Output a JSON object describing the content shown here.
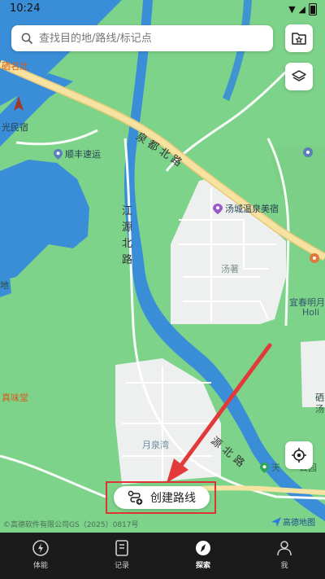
{
  "status_bar": {
    "time": "10:24"
  },
  "search": {
    "placeholder": "查找目的地/路线/标记点"
  },
  "map": {
    "poi": {
      "shunfeng": "顺丰速运",
      "tangcheng_hotel": "汤城温泉美宿",
      "yichun_holi": "宜春明月",
      "holi": "Holi",
      "zhenweitang": "真味堂",
      "tianshan": "天",
      "gongyuan": "公园",
      "guangminsu": "光民宿",
      "mingchaimingzao": "硒名灶",
      "xi_tang": "硒",
      "tang": "汤"
    },
    "roads": {
      "quandu_north": "泉都北路",
      "jiangyuan_north": "江源北路",
      "yuan_north": "源北路"
    },
    "areas": {
      "tangzhu": "汤著",
      "yuequanwan": "月泉湾",
      "di": "地"
    }
  },
  "actions": {
    "create_route": "创建路线"
  },
  "copyright": "©高德软件有限公司GS（2025）0817号",
  "map_provider": "高德地图",
  "tabs": [
    {
      "label": "体能",
      "icon": "bolt-icon",
      "active": false
    },
    {
      "label": "记录",
      "icon": "record-icon",
      "active": false
    },
    {
      "label": "探索",
      "icon": "compass-icon",
      "active": true
    },
    {
      "label": "我",
      "icon": "user-icon",
      "active": false
    }
  ],
  "colors": {
    "land": "#7dd389",
    "water": "#3a8ed8",
    "road": "#f6e3a2",
    "block": "#eef0ef",
    "highlight": "#e03333",
    "tabbar": "#1b1b1b"
  }
}
